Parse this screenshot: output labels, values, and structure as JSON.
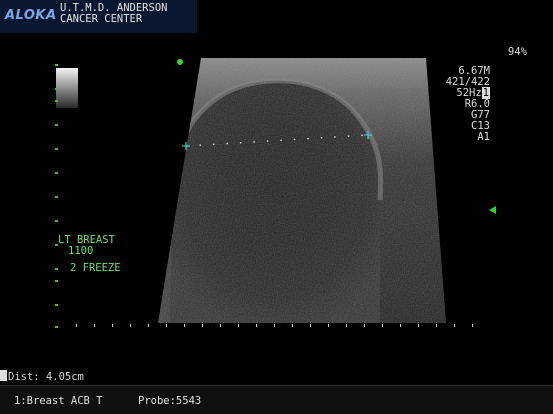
{
  "header": {
    "brand": "ALOKA",
    "institution_line1": "U.T.M.D. ANDERSON",
    "institution_line2": "CANCER CENTER"
  },
  "scan_params": {
    "zoom": "94%",
    "frequency": "6.67M",
    "frame": "421/422",
    "frame_rate": "52Hz",
    "frame_rate_mark": "1",
    "r": "R6.0",
    "g": "G77",
    "c": "C13",
    "a": "A1"
  },
  "annotation": {
    "line1": "LT BREAST",
    "line2": "1100",
    "line3": "2 FREEZE"
  },
  "measurement": {
    "dist": "Dist: 4.05cm"
  },
  "footer": {
    "preset": "1:Breast ACB T",
    "probe": "Probe:5543"
  },
  "colors": {
    "annotation_green": "#6fe06f",
    "marker_green": "#35d235",
    "caliper_cyan": "#49c9c9",
    "brand_blue": "#7ea5e8"
  }
}
